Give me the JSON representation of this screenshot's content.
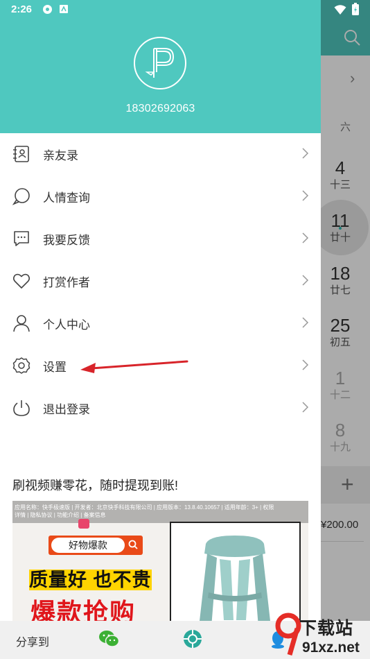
{
  "status_bar": {
    "time": "2:26"
  },
  "profile": {
    "phone": "18302692063"
  },
  "menu": [
    {
      "label": "亲友录",
      "icon": "contacts-book-icon"
    },
    {
      "label": "人情查询",
      "icon": "search-bubble-icon"
    },
    {
      "label": "我要反馈",
      "icon": "feedback-icon"
    },
    {
      "label": "打赏作者",
      "icon": "heart-icon"
    },
    {
      "label": "个人中心",
      "icon": "person-icon"
    },
    {
      "label": "设置",
      "icon": "gear-icon"
    },
    {
      "label": "退出登录",
      "icon": "power-icon"
    }
  ],
  "ad": {
    "title": "刷视频赚零花，随时提现到账!",
    "meta": "应用名称：快手极速版 | 开发者：北京快手科技有限公司 | 应用版本：13.8.40.10657 | 适用年龄：3+ | 权限",
    "meta_links": "详情 | 隐私协议 | 功能介绍 | 备案信息",
    "search_text": "好物爆款",
    "headline": "质量好 也不贵",
    "subline": "爆款抢购"
  },
  "share": {
    "label": "分享到"
  },
  "background": {
    "weekday": "六",
    "days": [
      {
        "num": "4",
        "lunar": "十三"
      },
      {
        "num": "11",
        "lunar": "廿十"
      },
      {
        "num": "18",
        "lunar": "廿七"
      },
      {
        "num": "25",
        "lunar": "初五"
      },
      {
        "num": "1",
        "lunar": "十二"
      },
      {
        "num": "8",
        "lunar": "十九"
      }
    ],
    "amount": "¥200.00"
  },
  "watermark": {
    "top": "下载站",
    "bottom": "91xz.net"
  },
  "colors": {
    "teal": "#4fc8bf",
    "arrow": "#d8242a"
  }
}
